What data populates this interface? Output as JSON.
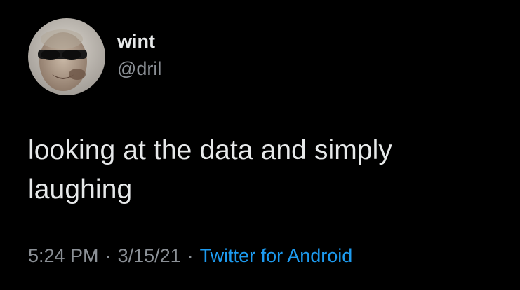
{
  "tweet": {
    "author": {
      "display_name": "wint",
      "handle": "@dril",
      "avatar_icon": "avatar-photo-sunglasses-man"
    },
    "text": "looking at the data and simply laughing",
    "time": "5:24 PM",
    "separator": "·",
    "date": "3/15/21",
    "source": "Twitter for Android"
  },
  "colors": {
    "background": "#000000",
    "primary_text": "#e7e9ea",
    "secondary_text": "#8b9096",
    "link": "#1d9bf0"
  }
}
